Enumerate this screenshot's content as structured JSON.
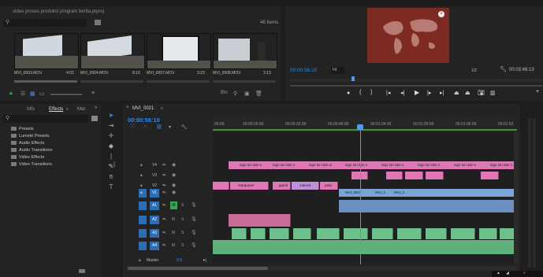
{
  "project": {
    "title": "video proses produksi program berita.prproj",
    "item_count": "46 Items",
    "clips": [
      {
        "name": "MVI_0003.MOV",
        "duration": "4:02"
      },
      {
        "name": "MVI_0004.MOV",
        "duration": "8:10"
      },
      {
        "name": "MVI_0007.MOV",
        "duration": "3:23"
      },
      {
        "name": "MVI_0008.MOV",
        "duration": "3:13"
      }
    ]
  },
  "monitor": {
    "timecode": "00:00:56:10",
    "fit": "Fit",
    "ratio": "1/2",
    "duration": "00:03:46:13"
  },
  "effects": {
    "tabs": [
      "Info",
      "Effects",
      "Mar"
    ],
    "items": [
      "Presets",
      "Lumetri Presets",
      "Audio Effects",
      "Audio Transitions",
      "Video Effects",
      "Video Transitions"
    ]
  },
  "timeline": {
    "sequence": "MVI_0021",
    "timecode": "00:00:56:10",
    "ruler": [
      "00:00",
      "00:00:16:00",
      "00:00:32:00",
      "00:00:48:00",
      "00:01:04:00",
      "00:01:20:00",
      "00:01:36:00",
      "00:01:52"
    ],
    "video_tracks": [
      "V4",
      "V3",
      "V2",
      "V1"
    ],
    "audio_tracks": [
      "A1",
      "A2",
      "A3",
      "A4"
    ],
    "master": {
      "label": "Master",
      "value": "0.0"
    },
    "v4_clips": [
      "logo lori dan s",
      "logo lori dan s",
      "logo lori dan sr",
      "logo lori dan s",
      "logo lori dan s",
      "logo lori dan s",
      "logo lori dan s",
      "logo lori dan s"
    ],
    "v2_clips": [
      "marqueee",
      "gamb",
      "marred",
      "peta"
    ],
    "v1_clips": [
      "MVI_0021",
      "MVI_0",
      "MVI_0"
    ]
  },
  "colors": {
    "accent_blue": "#2d8ceb",
    "playhead": "#4d9cf2",
    "pink": "#e176b6",
    "green": "#6cc08b",
    "blue": "#7aa3d6"
  }
}
